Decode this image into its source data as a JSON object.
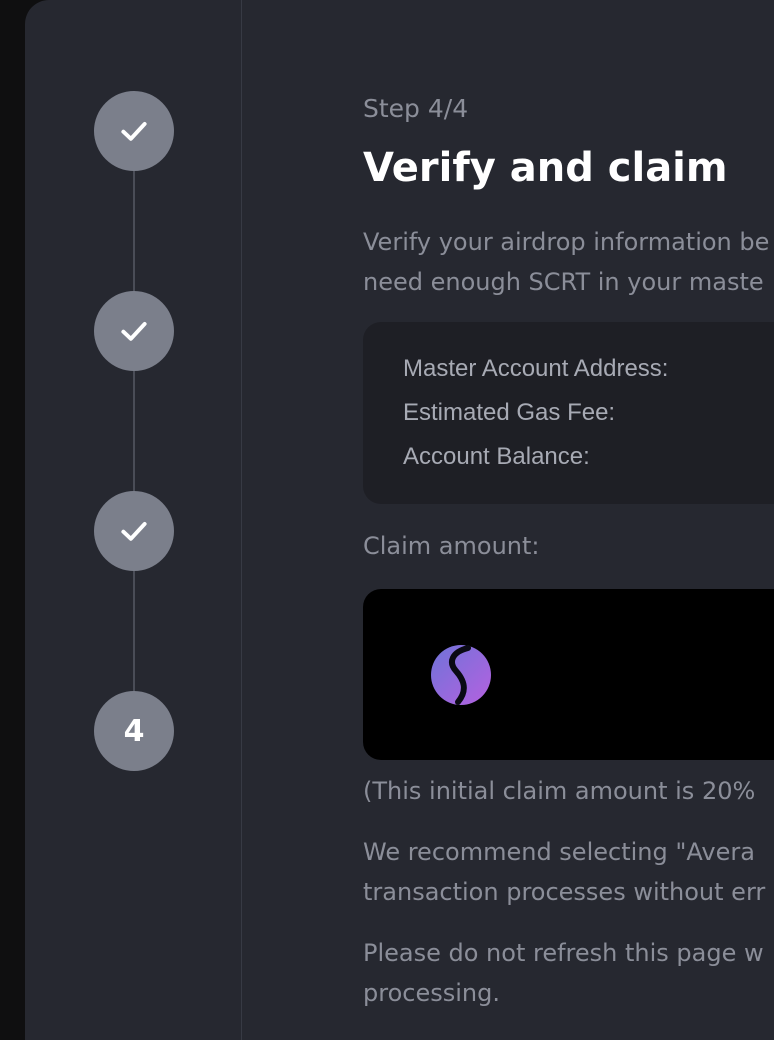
{
  "stepper": {
    "steps": [
      {
        "state": "completed",
        "icon": "check-icon"
      },
      {
        "state": "completed",
        "icon": "check-icon"
      },
      {
        "state": "completed",
        "icon": "check-icon"
      },
      {
        "state": "current",
        "number": "4"
      }
    ]
  },
  "main": {
    "step_label": "Step 4/4",
    "title": "Verify and claim",
    "description_line1": "Verify your airdrop information be",
    "description_line2": "need enough SCRT in your maste",
    "info": {
      "master_address_label": "Master Account Address:",
      "gas_fee_label": "Estimated Gas Fee:",
      "balance_label": "Account Balance:"
    },
    "claim_label": "Claim amount:",
    "claim_token_icon": "scrt-logo-icon",
    "note": "(This initial claim amount is 20%",
    "recommend_line1": "We recommend selecting \"Avera",
    "recommend_line2": "transaction processes without err",
    "refresh_line1": "Please do not refresh this page w",
    "refresh_line2": "processing."
  },
  "colors": {
    "background": "#262830",
    "step_circle": "#7b7f8b",
    "muted_text": "#8b8e99",
    "title_text": "#ffffff"
  }
}
